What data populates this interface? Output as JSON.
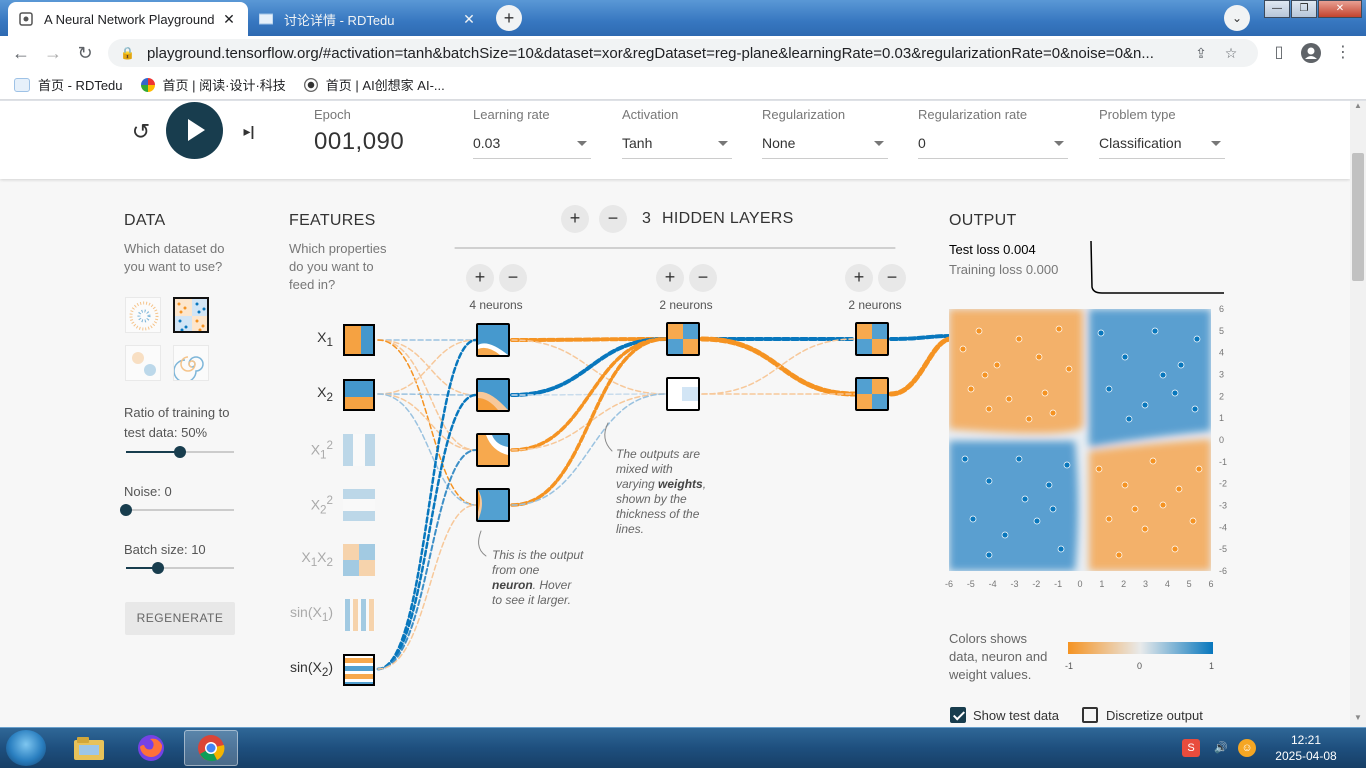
{
  "browser": {
    "tabs": [
      {
        "title": "A Neural Network Playground",
        "close": "✕"
      },
      {
        "title": "讨论详情 - RDTedu",
        "close": "✕"
      }
    ],
    "new_tab": "+",
    "url": "playground.tensorflow.org/#activation=tanh&batchSize=10&dataset=xor&regDataset=reg-plane&learningRate=0.03&regularizationRate=0&noise=0&n...",
    "bookmarks": [
      "首页 - RDTedu",
      "首页 | 阅读·设计·科技",
      "首页 | AI创想家 AI-..."
    ]
  },
  "controls": {
    "epoch_label": "Epoch",
    "epoch_value": "001,090",
    "learning_rate": {
      "label": "Learning rate",
      "value": "0.03"
    },
    "activation": {
      "label": "Activation",
      "value": "Tanh"
    },
    "regularization": {
      "label": "Regularization",
      "value": "None"
    },
    "regularization_rate": {
      "label": "Regularization rate",
      "value": "0"
    },
    "problem_type": {
      "label": "Problem type",
      "value": "Classification"
    }
  },
  "data_panel": {
    "title": "DATA",
    "subtitle_1": "Which dataset do",
    "subtitle_2": "you want to use?",
    "ratio_label_1": "Ratio of training to",
    "ratio_label_2": "test data:  50%",
    "ratio_value": 0.5,
    "noise_label": "Noise:  0",
    "noise_value": 0,
    "batch_label": "Batch size:  10",
    "batch_value": 0.3,
    "regenerate": "REGENERATE"
  },
  "features_panel": {
    "title": "FEATURES",
    "subtitle_1": "Which properties",
    "subtitle_2": "do you want to",
    "subtitle_3": "feed in?",
    "features": [
      {
        "base": "X",
        "sub": "1",
        "sup": ""
      },
      {
        "base": "X",
        "sub": "2",
        "sup": ""
      },
      {
        "base": "X",
        "sub": "1",
        "sup": "2"
      },
      {
        "base": "X",
        "sub": "2",
        "sup": "2"
      },
      {
        "base": "X",
        "sub": "1",
        "base2": "X",
        "sub2": "2"
      },
      {
        "base": "sin(X",
        "sub": "1",
        "close": ")"
      },
      {
        "base": "sin(X",
        "sub": "2",
        "close": ")"
      }
    ]
  },
  "network": {
    "plus": "+",
    "minus": "−",
    "hidden_count": "3",
    "hidden_label": "HIDDEN LAYERS",
    "layer_counts": [
      "4 neurons",
      "2 neurons",
      "2 neurons"
    ],
    "callout_weights": [
      "The outputs are",
      "mixed with",
      "varying ",
      "weights",
      ",",
      "shown by the",
      "thickness of the",
      "lines."
    ],
    "callout_neuron": [
      "This is the output",
      "from one",
      "neuron",
      ". Hover",
      "to see it larger."
    ]
  },
  "output_panel": {
    "title": "OUTPUT",
    "test_loss": "Test loss 0.004",
    "training_loss": "Training loss 0.000",
    "x_ticks": [
      "-6",
      "-5",
      "-4",
      "-3",
      "-2",
      "-1",
      "0",
      "1",
      "2",
      "3",
      "4",
      "5",
      "6"
    ],
    "y_ticks": [
      "6",
      "5",
      "4",
      "3",
      "2",
      "1",
      "0",
      "-1",
      "-2",
      "-3",
      "-4",
      "-5",
      "-6"
    ],
    "legend_text_1": "Colors shows",
    "legend_text_2": "data, neuron and",
    "legend_text_3": "weight values.",
    "legend_ticks": [
      "-1",
      "0",
      "1"
    ],
    "show_test_data": "Show test data",
    "discretize_output": "Discretize output"
  },
  "colors": {
    "orange": "#f59322",
    "blue": "#0877bd",
    "dark_navy": "#183d4e"
  },
  "taskbar": {
    "time": "12:21",
    "date": "2025-04-08"
  }
}
